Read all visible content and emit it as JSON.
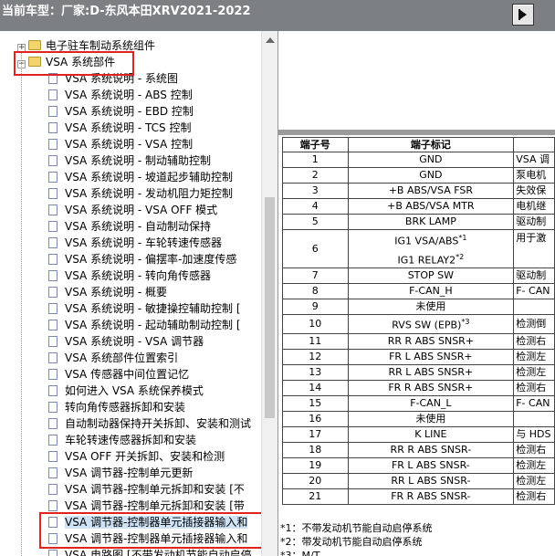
{
  "titlebar": {
    "label": "当前车型：",
    "model": "厂家:D-东风本田XRV2021-2022"
  },
  "tree": [
    {
      "text": "电子驻车制动系统组件",
      "type": "folder",
      "expander": "+",
      "indent": 1
    },
    {
      "text": "VSA 系统部件",
      "type": "folder",
      "expander": "−",
      "indent": 1,
      "highlight": true
    },
    {
      "text": "VSA 系统说明 - 系统图",
      "type": "doc"
    },
    {
      "text": "VSA 系统说明 - ABS 控制",
      "type": "doc"
    },
    {
      "text": "VSA 系统说明 - EBD 控制",
      "type": "doc"
    },
    {
      "text": "VSA 系统说明 - TCS 控制",
      "type": "doc"
    },
    {
      "text": "VSA 系统说明 - VSA 控制",
      "type": "doc"
    },
    {
      "text": "VSA 系统说明 - 制动辅助控制",
      "type": "doc"
    },
    {
      "text": "VSA 系统说明 - 坡道起步辅助控制",
      "type": "doc"
    },
    {
      "text": "VSA 系统说明 - 发动机阻力矩控制",
      "type": "doc"
    },
    {
      "text": "VSA 系统说明 - VSA OFF 模式",
      "type": "doc"
    },
    {
      "text": "VSA 系统说明 - 自动制动保持",
      "type": "doc"
    },
    {
      "text": "VSA 系统说明 - 车轮转速传感器",
      "type": "doc"
    },
    {
      "text": "VSA 系统说明 - 偏摆率-加速度传感",
      "type": "doc"
    },
    {
      "text": "VSA 系统说明 - 转向角传感器",
      "type": "doc"
    },
    {
      "text": "VSA 系统说明 - 概要",
      "type": "doc"
    },
    {
      "text": "VSA 系统说明 - 敏捷操控辅助控制 [",
      "type": "doc"
    },
    {
      "text": "VSA 系统说明 - 起动辅助制动控制 [",
      "type": "doc"
    },
    {
      "text": "VSA 系统说明 - VSA 调节器",
      "type": "doc"
    },
    {
      "text": "VSA 系统部件位置索引",
      "type": "doc"
    },
    {
      "text": "VSA 传感器中间位置记忆",
      "type": "doc"
    },
    {
      "text": "如何进入 VSA 系统保养模式",
      "type": "doc"
    },
    {
      "text": "转向角传感器拆卸和安装",
      "type": "doc"
    },
    {
      "text": "自动制动器保持开关拆卸、安装和测试",
      "type": "doc"
    },
    {
      "text": "车轮转速传感器拆卸和安装",
      "type": "doc"
    },
    {
      "text": "VSA OFF 开关拆卸、安装和检测",
      "type": "doc"
    },
    {
      "text": "VSA 调节器-控制单元更新",
      "type": "doc"
    },
    {
      "text": "VSA 调节器-控制单元拆卸和安装 [不",
      "type": "doc"
    },
    {
      "text": "VSA 调节器-控制单元拆卸和安装 [带",
      "type": "doc"
    },
    {
      "text": "VSA 调节器-控制器单元插接器输入和",
      "type": "doc",
      "selected": true
    },
    {
      "text": "VSA 调节器-控制器单元插接器输入和",
      "type": "doc"
    },
    {
      "text": "VSA 电路图 [不带发动机节能自动启停",
      "type": "doc"
    }
  ],
  "table": {
    "headers": [
      "端子号",
      "端子标记",
      ""
    ],
    "rows": [
      {
        "no": "1",
        "mark": "GND",
        "desc": "VSA 调"
      },
      {
        "no": "2",
        "mark": "GND",
        "desc": "泵电机"
      },
      {
        "no": "3",
        "mark": "+B ABS/VSA FSR",
        "desc": "失效保"
      },
      {
        "no": "4",
        "mark": "+B ABS/VSA MTR",
        "desc": "电机继"
      },
      {
        "no": "5",
        "mark": "BRK LAMP",
        "desc": "驱动制"
      },
      {
        "no": "6",
        "mark": "IG1 VSA/ABS",
        "sup": "*1",
        "mark2": "IG1 RELAY2",
        "sup2": "*2",
        "desc": "用于激"
      },
      {
        "no": "7",
        "mark": "STOP SW",
        "desc": "驱动制"
      },
      {
        "no": "8",
        "mark": "F-CAN_H",
        "desc": "F- CAN"
      },
      {
        "no": "9",
        "mark": "未使用",
        "desc": ""
      },
      {
        "no": "10",
        "mark": "RVS SW (EPB)",
        "sup": "*3",
        "desc": "检测倒"
      },
      {
        "no": "11",
        "mark": "RR R ABS SNSR+",
        "desc": "检测右"
      },
      {
        "no": "12",
        "mark": "FR L ABS SNSR+",
        "desc": "检测左"
      },
      {
        "no": "13",
        "mark": "RR L ABS SNSR+",
        "desc": "检测左"
      },
      {
        "no": "14",
        "mark": "FR R ABS SNSR+",
        "desc": "检测右"
      },
      {
        "no": "15",
        "mark": "F-CAN_L",
        "desc": "F- CAN"
      },
      {
        "no": "16",
        "mark": "未使用",
        "desc": ""
      },
      {
        "no": "17",
        "mark": "K LINE",
        "desc": "与 HDS"
      },
      {
        "no": "18",
        "mark": "RR R ABS SNSR-",
        "desc": "检测右"
      },
      {
        "no": "19",
        "mark": "FR L ABS SNSR-",
        "desc": "检测左"
      },
      {
        "no": "20",
        "mark": "RR L ABS SNSR-",
        "desc": "检测左"
      },
      {
        "no": "21",
        "mark": "FR R ABS SNSR-",
        "desc": "检测右"
      }
    ]
  },
  "notes": [
    "*1：不带发动机节能自动启停系统",
    "*2：带发动机节能自动启停系统",
    "*3：M/T"
  ]
}
